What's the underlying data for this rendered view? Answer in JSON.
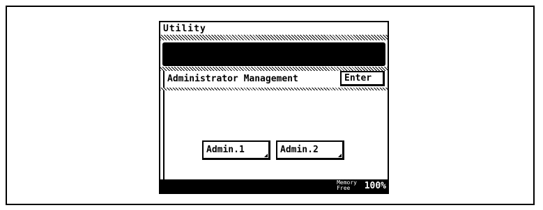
{
  "title": "Utility",
  "message": "",
  "section": {
    "label": "Administrator Management",
    "enter_label": "Enter"
  },
  "buttons": {
    "admin1": "Admin.1",
    "admin2": "Admin.2"
  },
  "status": {
    "memory_line1": "Memory",
    "memory_line2": "Free",
    "memory_value": "100%"
  }
}
